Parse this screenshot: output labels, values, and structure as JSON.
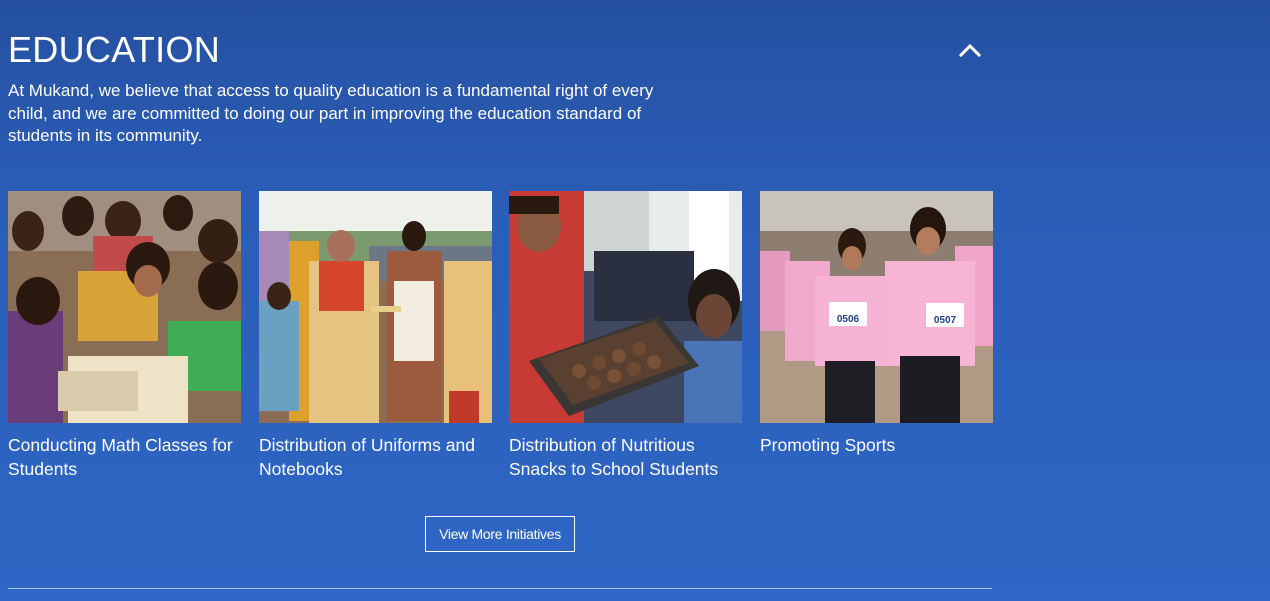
{
  "section": {
    "title": "EDUCATION",
    "intro": "At Mukand, we believe that access to quality education is a fundamental right of every child, and we are committed to doing our part in improving the education standard of students in its community.",
    "collapse_icon": "chevron-up-icon"
  },
  "cards": [
    {
      "caption": "Conducting Math Classes for Students"
    },
    {
      "caption": "Distribution of Uniforms and Notebooks"
    },
    {
      "caption": "Distribution of Nutritious Snacks to School Students"
    },
    {
      "caption": "Promoting Sports",
      "bibs": [
        "0506",
        "0507"
      ]
    }
  ],
  "more_button": {
    "label": "View More Initiatives"
  }
}
